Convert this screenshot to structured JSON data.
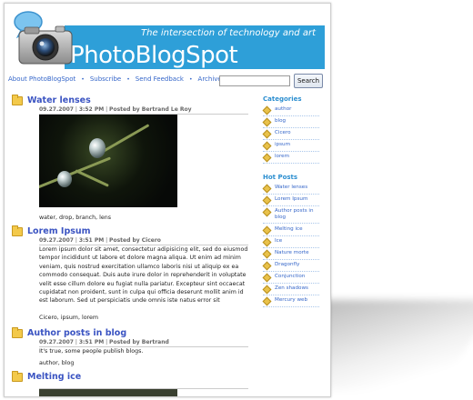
{
  "header": {
    "site_title": "PhotoBlogSpot",
    "tagline": "The intersection of technology and art",
    "banner_color": "#2e9fd8"
  },
  "nav": {
    "items": [
      "About PhotoBlogSpot",
      "Subscribe",
      "Send Feedback",
      "Archive"
    ],
    "search_button": "Search"
  },
  "posts": [
    {
      "title": "Water lenses",
      "meta_date": "09.27.2007",
      "meta_time": "3:52 PM",
      "meta_author": "Posted by Bertrand Le Roy",
      "tags": "water, drop, branch, lens"
    },
    {
      "title": "Lorem Ipsum",
      "meta_date": "09.27.2007",
      "meta_time": "3:51 PM",
      "meta_author": "Posted by Cicero",
      "body": "Lorem ipsum dolor sit amet, consectetur adipisicing elit, sed do eiusmod tempor incididunt ut labore et dolore magna aliqua. Ut enim ad minim veniam, quis nostrud exercitation ullamco laboris nisi ut aliquip ex ea commodo consequat. Duis aute irure dolor in reprehenderit in voluptate velit esse cillum dolore eu fugiat nulla pariatur. Excepteur sint occaecat cupidatat non proident, sunt in culpa qui officia deserunt mollit anim id est laborum. Sed ut perspiciatis unde omnis iste natus error sit",
      "tags": "Cicero, ipsum, lorem"
    },
    {
      "title": "Author posts in blog",
      "meta_date": "09.27.2007",
      "meta_time": "3:51 PM",
      "meta_author": "Posted by Bertrand",
      "body": "It's true, some people publish blogs.",
      "tags": "author, blog"
    },
    {
      "title": "Melting ice"
    }
  ],
  "sidebar": {
    "categories_heading": "Categories",
    "categories": [
      "author",
      "blog",
      "Cicero",
      "ipsum",
      "lorem"
    ],
    "hot_posts_heading": "Hot Posts",
    "hot_posts": [
      "Water lenses",
      "Lorem Ipsum",
      "Author posts in blog",
      "Melting ice",
      "Ice",
      "Nature morte",
      "Dragonfly",
      "Conjunction",
      "Zen shadows",
      "Mercury web"
    ]
  }
}
